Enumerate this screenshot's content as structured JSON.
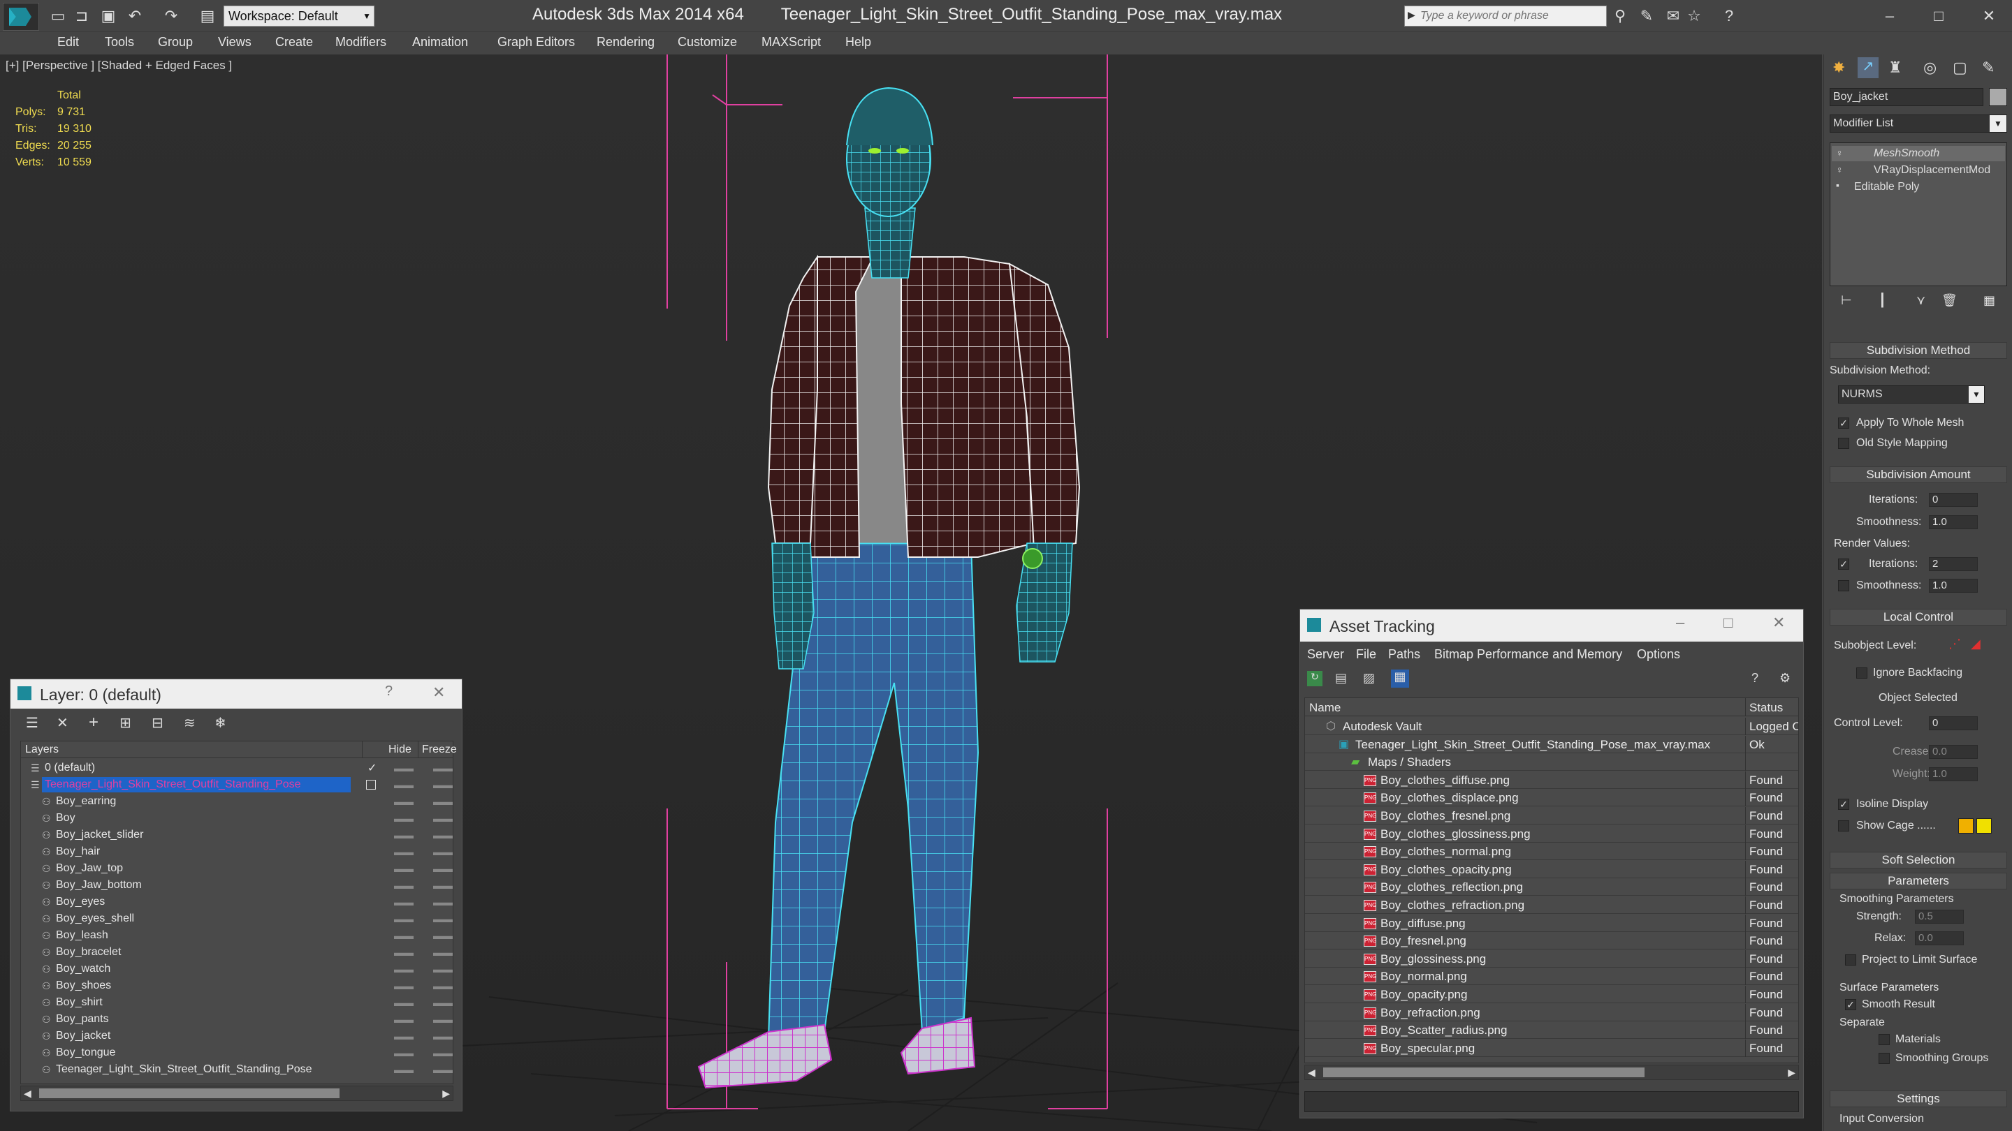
{
  "app": {
    "title": "Autodesk 3ds Max  2014 x64",
    "file": "Teenager_Light_Skin_Street_Outfit_Standing_Pose_max_vray.max",
    "workspace": "Workspace: Default",
    "search_placeholder": "Type a keyword or phrase"
  },
  "menu": [
    "Edit",
    "Tools",
    "Group",
    "Views",
    "Create",
    "Modifiers",
    "Animation",
    "Graph Editors",
    "Rendering",
    "Customize",
    "MAXScript",
    "Help"
  ],
  "viewport": {
    "label": "[+] [Perspective ] [Shaded + Edged Faces ]",
    "stats": {
      "header": "Total",
      "rows": [
        {
          "label": "Polys:",
          "value": "9 731"
        },
        {
          "label": "Tris:",
          "value": "19 310"
        },
        {
          "label": "Edges:",
          "value": "20 255"
        },
        {
          "label": "Verts:",
          "value": "10 559"
        }
      ]
    }
  },
  "command_panel": {
    "object_name": "Boy_jacket",
    "modifier_list": "Modifier List",
    "stack": [
      "MeshSmooth",
      "VRayDisplacementMod",
      "Editable Poly"
    ],
    "subdivision_method": {
      "title": "Subdivision Method",
      "label": "Subdivision Method:",
      "value": "NURMS",
      "apply_whole_mesh": "Apply To Whole Mesh",
      "old_style_mapping": "Old Style Mapping"
    },
    "subdivision_amount": {
      "title": "Subdivision Amount",
      "iterations_label": "Iterations:",
      "iterations": "0",
      "smoothness_label": "Smoothness:",
      "smoothness": "1.0",
      "render_values": "Render Values:",
      "render_iterations_label": "Iterations:",
      "render_iterations": "2",
      "render_smoothness_label": "Smoothness:",
      "render_smoothness": "1.0"
    },
    "local_control": {
      "title": "Local Control",
      "subobject_level": "Subobject Level:",
      "ignore_backfacing": "Ignore Backfacing",
      "object_selected": "Object Selected",
      "control_level_label": "Control Level:",
      "control_level": "0",
      "crease_label": "Crease:",
      "crease": "0.0",
      "weight_label": "Weight:",
      "weight": "1.0",
      "isoline_display": "Isoline Display",
      "show_cage": "Show Cage ......"
    },
    "soft_selection": "Soft Selection",
    "parameters": {
      "title": "Parameters",
      "smoothing_parameters": "Smoothing Parameters",
      "strength_label": "Strength:",
      "strength": "0.5",
      "relax_label": "Relax:",
      "relax": "0.0",
      "project_limit": "Project to Limit Surface",
      "surface_parameters": "Surface Parameters",
      "smooth_result": "Smooth Result",
      "separate": "Separate",
      "materials": "Materials",
      "smoothing_groups": "Smoothing Groups"
    },
    "settings": "Settings",
    "input_conversion": "Input Conversion"
  },
  "layer_window": {
    "title": "Layer: 0 (default)",
    "help": "?",
    "col_layers": "Layers",
    "col_hide": "Hide",
    "col_freeze": "Freeze",
    "rows": [
      {
        "name": "0 (default)",
        "indent": 0,
        "selected": false,
        "check": "✓"
      },
      {
        "name": "Teenager_Light_Skin_Street_Outfit_Standing_Pose",
        "indent": 0,
        "selected": true,
        "check": ""
      },
      {
        "name": "Boy_earring",
        "indent": 1,
        "selected": false,
        "check": ""
      },
      {
        "name": "Boy",
        "indent": 1,
        "selected": false,
        "check": ""
      },
      {
        "name": "Boy_jacket_slider",
        "indent": 1,
        "selected": false,
        "check": ""
      },
      {
        "name": "Boy_hair",
        "indent": 1,
        "selected": false,
        "check": ""
      },
      {
        "name": "Boy_Jaw_top",
        "indent": 1,
        "selected": false,
        "check": ""
      },
      {
        "name": "Boy_Jaw_bottom",
        "indent": 1,
        "selected": false,
        "check": ""
      },
      {
        "name": "Boy_eyes",
        "indent": 1,
        "selected": false,
        "check": ""
      },
      {
        "name": "Boy_eyes_shell",
        "indent": 1,
        "selected": false,
        "check": ""
      },
      {
        "name": "Boy_leash",
        "indent": 1,
        "selected": false,
        "check": ""
      },
      {
        "name": "Boy_bracelet",
        "indent": 1,
        "selected": false,
        "check": ""
      },
      {
        "name": "Boy_watch",
        "indent": 1,
        "selected": false,
        "check": ""
      },
      {
        "name": "Boy_shoes",
        "indent": 1,
        "selected": false,
        "check": ""
      },
      {
        "name": "Boy_shirt",
        "indent": 1,
        "selected": false,
        "check": ""
      },
      {
        "name": "Boy_pants",
        "indent": 1,
        "selected": false,
        "check": ""
      },
      {
        "name": "Boy_jacket",
        "indent": 1,
        "selected": false,
        "check": ""
      },
      {
        "name": "Boy_tongue",
        "indent": 1,
        "selected": false,
        "check": ""
      },
      {
        "name": "Teenager_Light_Skin_Street_Outfit_Standing_Pose",
        "indent": 1,
        "selected": false,
        "check": ""
      }
    ]
  },
  "asset_window": {
    "title": "Asset Tracking",
    "menu": [
      "Server",
      "File",
      "Paths",
      "Bitmap Performance and Memory",
      "Options"
    ],
    "col_name": "Name",
    "col_status": "Status",
    "rows": [
      {
        "name": "Autodesk Vault",
        "status": "Logged O",
        "level": 0,
        "icon": "vault"
      },
      {
        "name": "Teenager_Light_Skin_Street_Outfit_Standing_Pose_max_vray.max",
        "status": "Ok",
        "level": 1,
        "icon": "max"
      },
      {
        "name": "Maps / Shaders",
        "status": "",
        "level": 2,
        "icon": "maps"
      },
      {
        "name": "Boy_clothes_diffuse.png",
        "status": "Found",
        "level": 3,
        "icon": "png"
      },
      {
        "name": "Boy_clothes_displace.png",
        "status": "Found",
        "level": 3,
        "icon": "png"
      },
      {
        "name": "Boy_clothes_fresnel.png",
        "status": "Found",
        "level": 3,
        "icon": "png"
      },
      {
        "name": "Boy_clothes_glossiness.png",
        "status": "Found",
        "level": 3,
        "icon": "png"
      },
      {
        "name": "Boy_clothes_normal.png",
        "status": "Found",
        "level": 3,
        "icon": "png"
      },
      {
        "name": "Boy_clothes_opacity.png",
        "status": "Found",
        "level": 3,
        "icon": "png"
      },
      {
        "name": "Boy_clothes_reflection.png",
        "status": "Found",
        "level": 3,
        "icon": "png"
      },
      {
        "name": "Boy_clothes_refraction.png",
        "status": "Found",
        "level": 3,
        "icon": "png"
      },
      {
        "name": "Boy_diffuse.png",
        "status": "Found",
        "level": 3,
        "icon": "png"
      },
      {
        "name": "Boy_fresnel.png",
        "status": "Found",
        "level": 3,
        "icon": "png"
      },
      {
        "name": "Boy_glossiness.png",
        "status": "Found",
        "level": 3,
        "icon": "png"
      },
      {
        "name": "Boy_normal.png",
        "status": "Found",
        "level": 3,
        "icon": "png"
      },
      {
        "name": "Boy_opacity.png",
        "status": "Found",
        "level": 3,
        "icon": "png"
      },
      {
        "name": "Boy_refraction.png",
        "status": "Found",
        "level": 3,
        "icon": "png"
      },
      {
        "name": "Boy_Scatter_radius.png",
        "status": "Found",
        "level": 3,
        "icon": "png"
      },
      {
        "name": "Boy_specular.png",
        "status": "Found",
        "level": 3,
        "icon": "png"
      }
    ]
  },
  "colors": {
    "selection_blue": "#1e64c8",
    "stats_yellow": "#f0dc50",
    "wire_cyan": "#3ad7ee",
    "bbox_pink": "#e040a0",
    "shoe_magenta": "#c030c0"
  }
}
